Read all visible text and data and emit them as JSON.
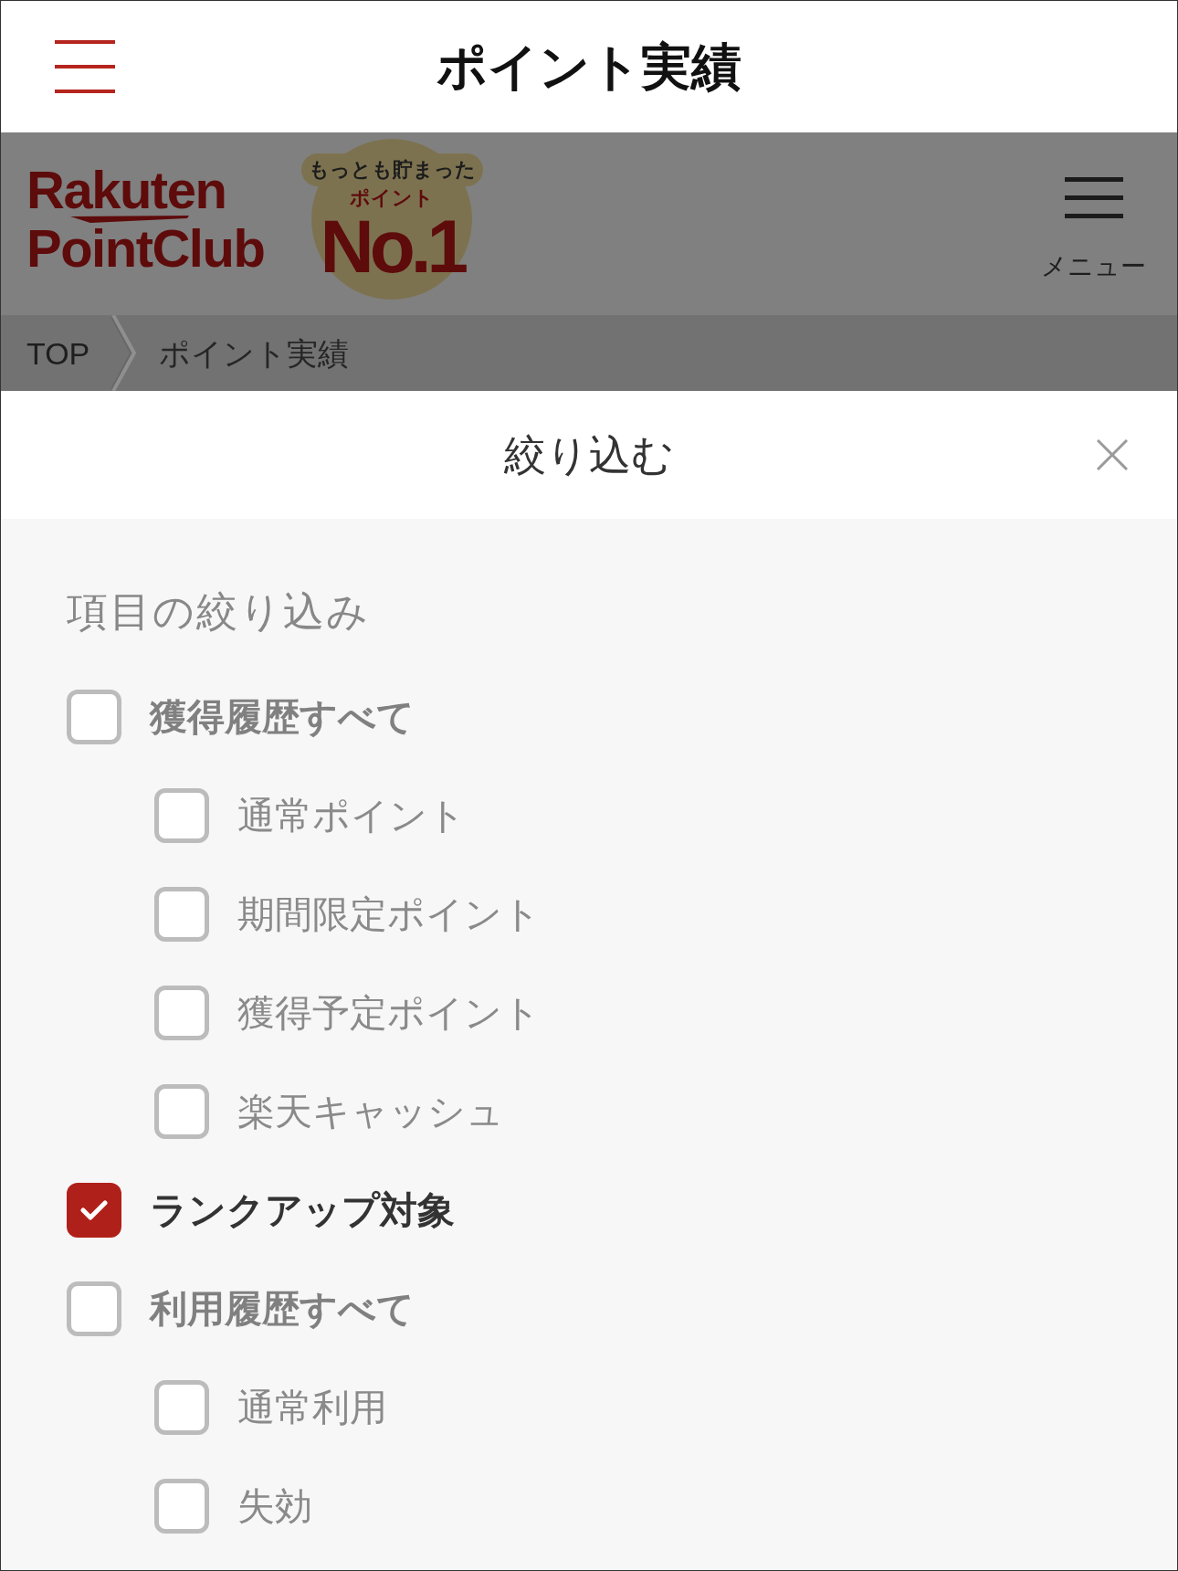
{
  "app_bar": {
    "title": "ポイント実績"
  },
  "site_header": {
    "logo_lines": [
      "Rakuten",
      "PointClub"
    ],
    "badge": {
      "caption": "もっとも貯まった",
      "subtitle": "ポイント",
      "rank": "No.1"
    },
    "menu_label": "メニュー"
  },
  "breadcrumb": [
    {
      "label": "TOP"
    },
    {
      "label": "ポイント実績"
    }
  ],
  "filter_sheet": {
    "title": "絞り込む",
    "section_title": "項目の絞り込み",
    "options": [
      {
        "label": "獲得履歴すべて",
        "checked": false,
        "children": [
          {
            "label": "通常ポイント",
            "checked": false
          },
          {
            "label": "期間限定ポイント",
            "checked": false
          },
          {
            "label": "獲得予定ポイント",
            "checked": false
          },
          {
            "label": "楽天キャッシュ",
            "checked": false
          }
        ]
      },
      {
        "label": "ランクアップ対象",
        "checked": true
      },
      {
        "label": "利用履歴すべて",
        "checked": false,
        "children": [
          {
            "label": "通常利用",
            "checked": false
          },
          {
            "label": "失効",
            "checked": false
          }
        ]
      }
    ]
  }
}
